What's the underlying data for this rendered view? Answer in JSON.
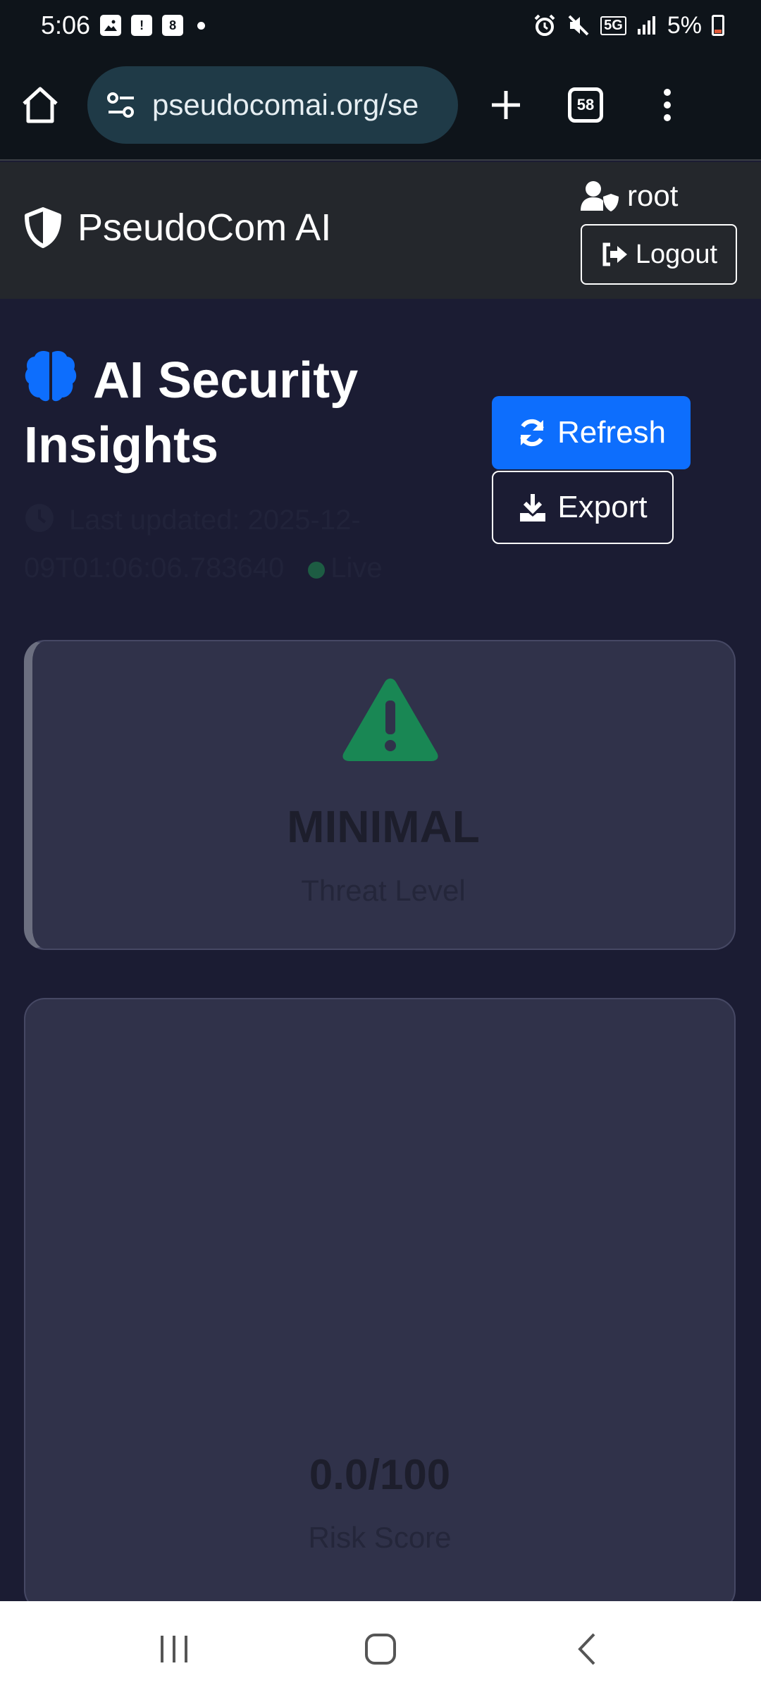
{
  "status_bar": {
    "time": "5:06",
    "notif_calendar_day": "8",
    "network": "5G",
    "battery_percent": "5%"
  },
  "browser": {
    "url": "pseudocomai.org/se",
    "tab_count": "58"
  },
  "app_nav": {
    "brand": "PseudoCom AI",
    "username": "root",
    "logout_label": "Logout"
  },
  "page": {
    "title": "AI Security Insights",
    "refresh_label": "Refresh",
    "export_label": "Export",
    "last_updated": "Last updated: 2025-12-09T01:06:06.783640",
    "live_label": "Live"
  },
  "threat_card": {
    "level": "MINIMAL",
    "label": "Threat Level"
  },
  "risk_card": {
    "score": "0.0/100",
    "label": "Risk Score"
  },
  "colors": {
    "accent": "#0d6efd",
    "threat_icon": "#198754",
    "background": "#1b1c33"
  },
  "icons": {
    "brand": "shield-halved-icon",
    "title": "brain-icon",
    "refresh": "sync-icon",
    "export": "download-icon",
    "logout": "sign-out-icon",
    "user": "user-shield-icon",
    "threat": "triangle-exclamation-icon"
  }
}
